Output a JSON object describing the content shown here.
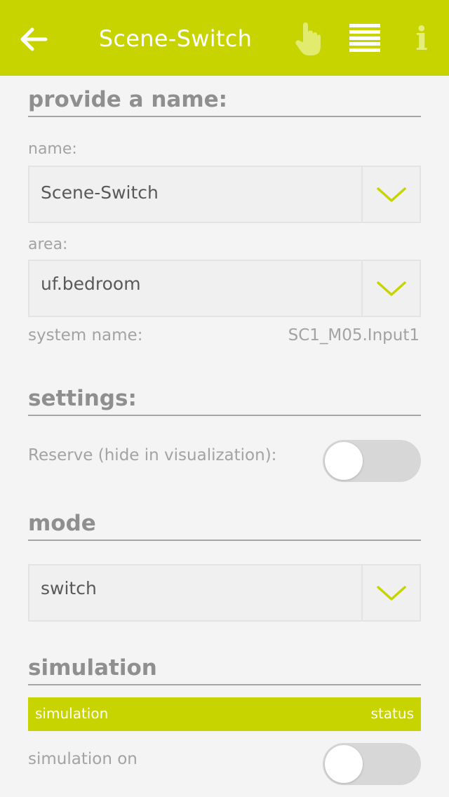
{
  "header": {
    "title": "Scene-Switch",
    "back_icon": "arrow-left-icon",
    "hand_icon": "hand-pointer-icon",
    "menu_icon": "hamburger-menu-icon",
    "info_icon": "info-icon",
    "info_glyph": "i",
    "accent": "#c8d400"
  },
  "name_section": {
    "title": "provide a name:",
    "name_label": "name:",
    "name_value": "Scene-Switch",
    "area_label": "area:",
    "area_value": "uf.bedroom",
    "system_name_label": "system name:",
    "system_name_value": "SC1_M05.Input1"
  },
  "settings_section": {
    "title": "settings:",
    "reserve_label": "Reserve (hide in visualization):",
    "reserve_on": false
  },
  "mode_section": {
    "title": "mode",
    "mode_value": "switch"
  },
  "simulation_section": {
    "title": "simulation",
    "header_left": "simulation",
    "header_right": "status",
    "sim_on_label": "simulation on",
    "sim_on": false
  }
}
